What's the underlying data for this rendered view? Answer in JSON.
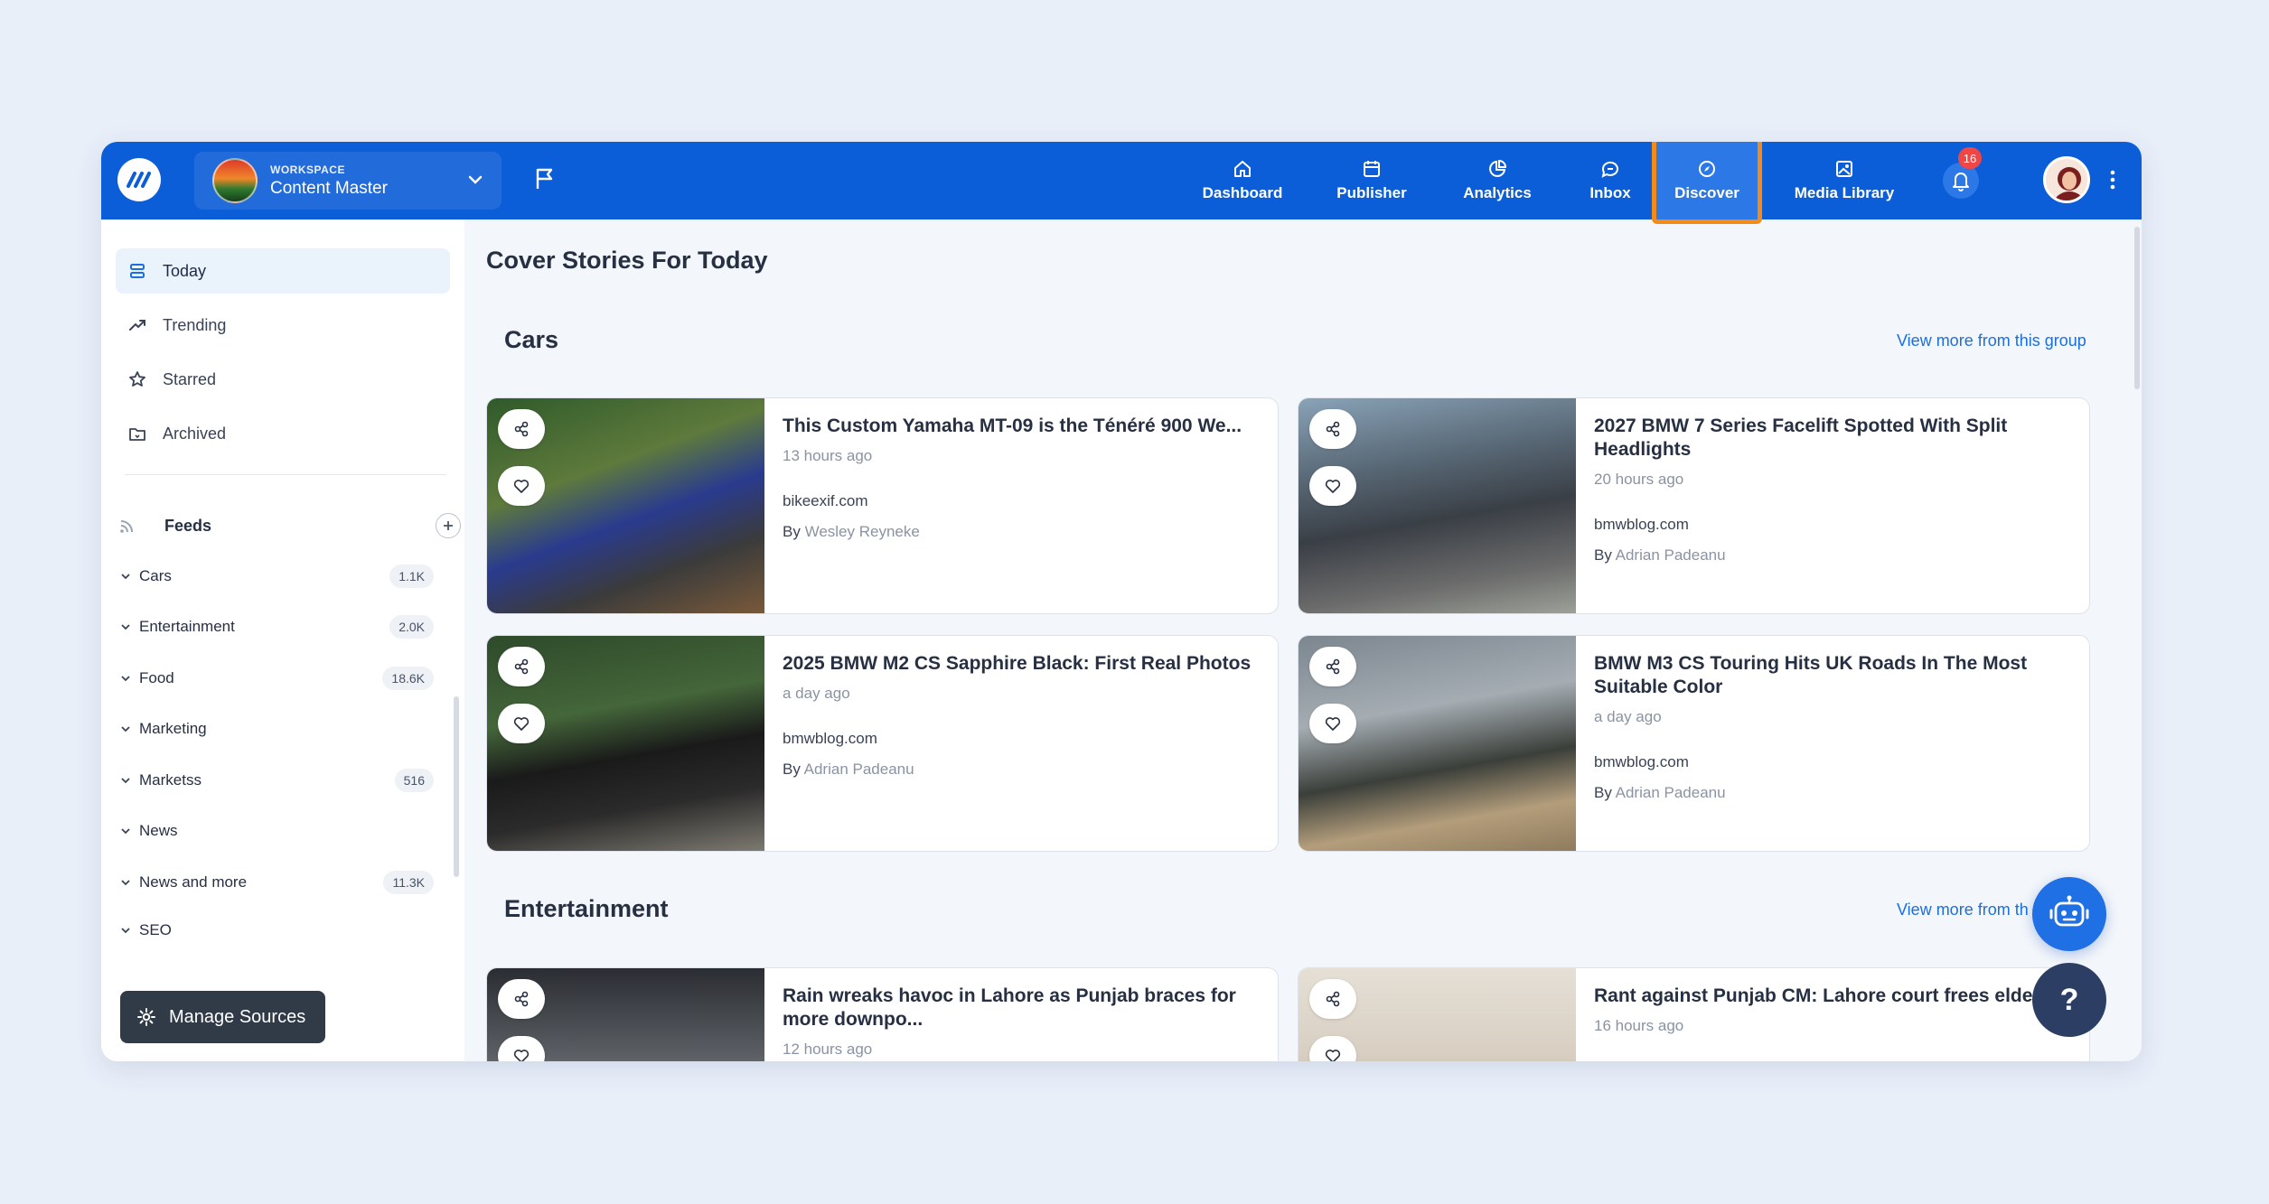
{
  "topbar": {
    "workspace_label": "WORKSPACE",
    "workspace_name": "Content Master",
    "nav": [
      {
        "label": "Dashboard"
      },
      {
        "label": "Publisher"
      },
      {
        "label": "Analytics"
      },
      {
        "label": "Inbox"
      },
      {
        "label": "Discover"
      },
      {
        "label": "Media Library"
      }
    ],
    "notification_count": "16",
    "active_nav": "Discover",
    "brand_color": "#0b5ed7",
    "highlight_color": "#f28b18"
  },
  "sidebar": {
    "items": [
      {
        "label": "Today",
        "icon": "stack-icon",
        "active": true
      },
      {
        "label": "Trending",
        "icon": "trending-icon"
      },
      {
        "label": "Starred",
        "icon": "star-icon"
      },
      {
        "label": "Archived",
        "icon": "archive-icon"
      }
    ],
    "feeds_label": "Feeds",
    "feeds": [
      {
        "label": "Cars",
        "count": "1.1K"
      },
      {
        "label": "Entertainment",
        "count": "2.0K"
      },
      {
        "label": "Food",
        "count": "18.6K"
      },
      {
        "label": "Marketing",
        "count": ""
      },
      {
        "label": "Marketss",
        "count": "516"
      },
      {
        "label": "News",
        "count": ""
      },
      {
        "label": "News and more",
        "count": "11.3K"
      },
      {
        "label": "SEO",
        "count": ""
      }
    ],
    "manage_label": "Manage Sources"
  },
  "main": {
    "page_title": "Cover Stories For Today",
    "sections": [
      {
        "title": "Cars",
        "view_more": "View more from this group",
        "cards": [
          {
            "title": "This Custom Yamaha MT-09 is the Ténéré 900 We...",
            "time": "13 hours ago",
            "domain": "bikeexif.com",
            "by": "By",
            "author": "Wesley Reyneke"
          },
          {
            "title": "2027 BMW 7 Series Facelift Spotted With Split Headlights",
            "time": "20 hours ago",
            "domain": "bmwblog.com",
            "by": "By",
            "author": "Adrian Padeanu"
          },
          {
            "title": "2025 BMW M2 CS Sapphire Black: First Real Photos",
            "time": "a day ago",
            "domain": "bmwblog.com",
            "by": "By",
            "author": "Adrian Padeanu"
          },
          {
            "title": "BMW M3 CS Touring Hits UK Roads In The Most Suitable Color",
            "time": "a day ago",
            "domain": "bmwblog.com",
            "by": "By",
            "author": "Adrian Padeanu"
          }
        ]
      },
      {
        "title": "Entertainment",
        "view_more": "View more from th",
        "cards": [
          {
            "title": "Rain wreaks havoc in Lahore as Punjab braces for more downpo...",
            "time": "12 hours ago"
          },
          {
            "title": "Rant against Punjab CM: Lahore court frees elderly m",
            "time": "16 hours ago"
          }
        ]
      }
    ]
  },
  "help_label": "?"
}
